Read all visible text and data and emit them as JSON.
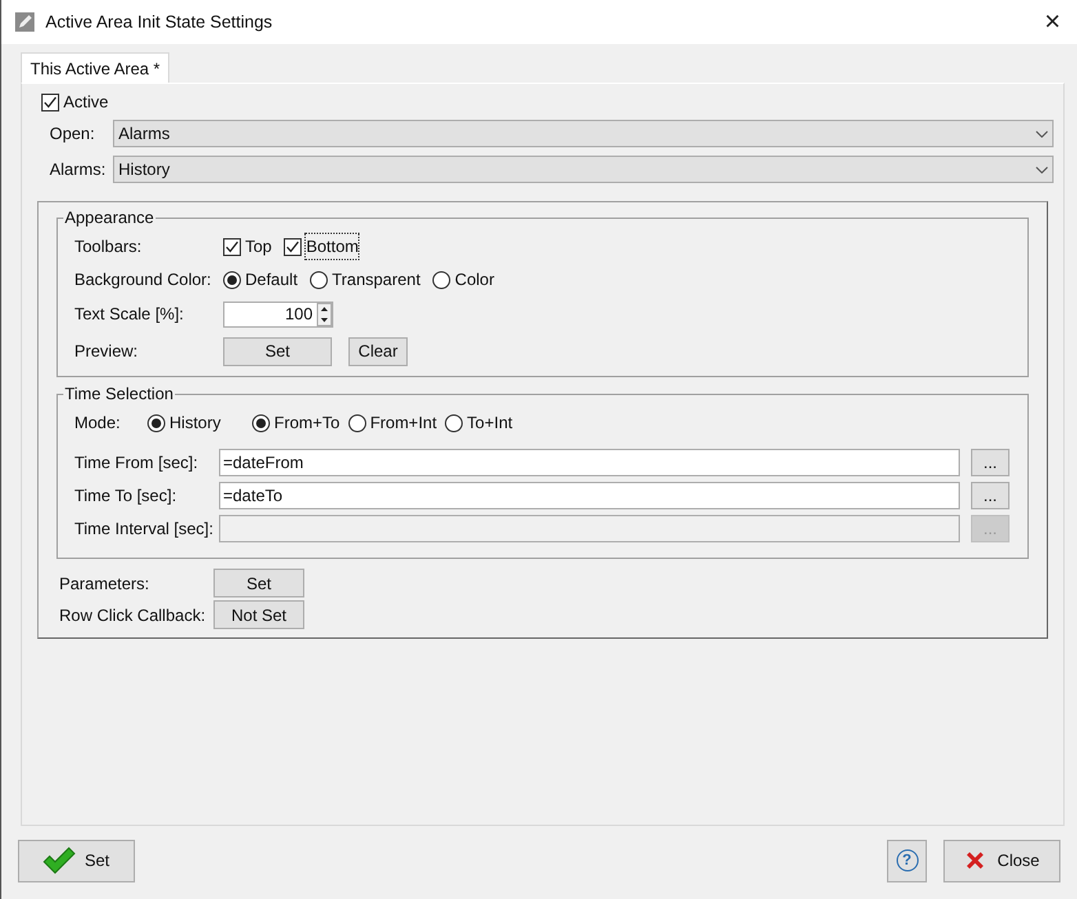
{
  "window": {
    "title": "Active Area Init State Settings",
    "close": "×"
  },
  "tabs": [
    {
      "label": "This Active Area *",
      "selected": true
    }
  ],
  "active": {
    "label": "Active",
    "checked": true
  },
  "dropdowns": [
    {
      "label": "Open:",
      "value": "Alarms"
    },
    {
      "label": "Alarms:",
      "value": "History"
    }
  ],
  "appearance": {
    "title": "Appearance",
    "toolbars": {
      "label": "Toolbars:",
      "options": [
        {
          "label": "Top",
          "checked": true,
          "focused": false
        },
        {
          "label": "Bottom",
          "checked": true,
          "focused": true
        }
      ]
    },
    "background": {
      "label": "Background Color:",
      "options": [
        {
          "label": "Default",
          "selected": true
        },
        {
          "label": "Transparent",
          "selected": false
        },
        {
          "label": "Color",
          "selected": false
        }
      ]
    },
    "text_scale": {
      "label": "Text Scale [%]:",
      "value": "100"
    },
    "preview": {
      "label": "Preview:",
      "buttons": [
        "Set",
        "Clear"
      ]
    }
  },
  "time_selection": {
    "title": "Time Selection",
    "mode_label": "Mode:",
    "mode_groups": [
      [
        {
          "label": "History",
          "selected": true
        }
      ],
      [
        {
          "label": "From+To",
          "selected": true
        },
        {
          "label": "From+Int",
          "selected": false
        },
        {
          "label": "To+Int",
          "selected": false
        }
      ]
    ],
    "fields": [
      {
        "label": "Time From [sec]:",
        "value": "=dateFrom",
        "disabled": false,
        "button": "..."
      },
      {
        "label": "Time To [sec]:",
        "value": "=dateTo",
        "disabled": false,
        "button": "..."
      },
      {
        "label": "Time Interval [sec]:",
        "disabled": true,
        "button": "..."
      }
    ]
  },
  "extras": [
    {
      "label": "Parameters:",
      "button": "Set"
    },
    {
      "label": "Row Click Callback:",
      "button": "Not Set"
    }
  ],
  "footer": {
    "ok": "Set",
    "help": "?",
    "close": "Close"
  }
}
